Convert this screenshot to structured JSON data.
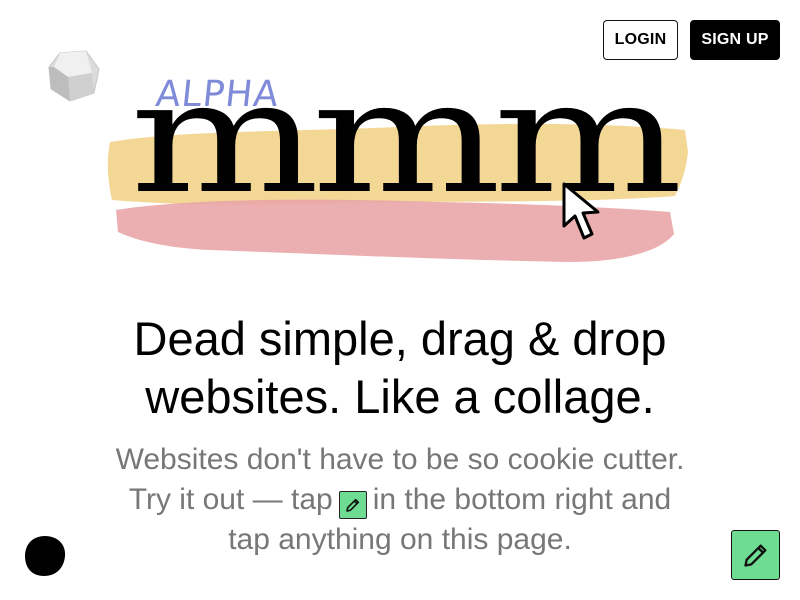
{
  "header": {
    "login_label": "LOGIN",
    "signup_label": "SIGN UP"
  },
  "badge": {
    "alpha_label": "ALPHA"
  },
  "logo": {
    "text": "mmm",
    "paint_colors": {
      "yellow": "#f2d38a",
      "pink": "#e9a6a8"
    }
  },
  "hero": {
    "headline_line1": "Dead simple, drag & drop",
    "headline_line2": "websites. Like a collage.",
    "sub_part1": "Websites don't have to be so cookie cutter. Try it out — tap",
    "sub_part2": "in the bottom right and tap anything on this page."
  },
  "icons": {
    "gem": "gem-icon",
    "cursor": "cursor-arrow-icon",
    "pencil": "pencil-icon",
    "blob": "blob-shape"
  },
  "colors": {
    "accent_green": "#6fdc93",
    "alpha_blue": "#7f8bd9",
    "subtext_gray": "#777777"
  }
}
